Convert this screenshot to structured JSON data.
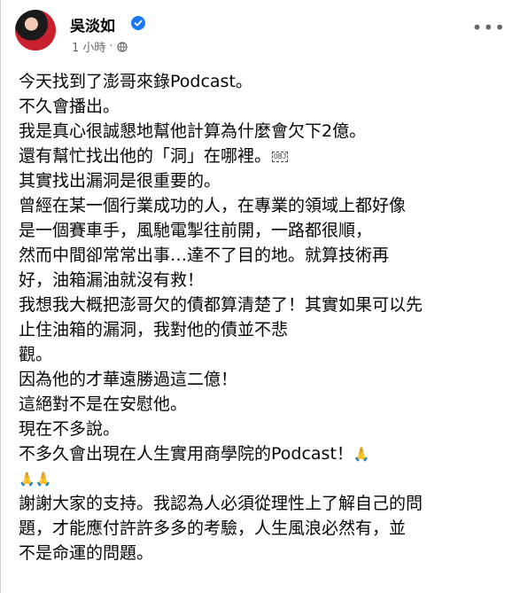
{
  "post": {
    "author": "吳淡如",
    "time": "1 小時",
    "dot": "·",
    "verified_icon": "verified-badge-icon",
    "privacy_icon": "globe-icon",
    "more_icon": "more-options-icon"
  },
  "lines": [
    "今天找到了澎哥來錄Podcast。",
    "不久會播出。",
    "我是真心很誠懇地幫他計算為什麼會欠下2億。",
    "還有幫忙找出他的「洞」在哪裡。",
    "其實找出漏洞是很重要的。",
    "曾經在某一個行業成功的人，在專業的領域上都好像",
    "是一個賽車手，風馳電掣往前開，一路都很順，",
    "然而中間卻常常出事…達不了目的地。就算技術再",
    "好，油箱漏油就沒有救！",
    "我想我大概把澎哥欠的債都算清楚了！其實如果可以先",
    "止住油箱的漏洞，我對他的債並不悲",
    "觀。",
    "因為他的才華遠勝過這二億！",
    "這絕對不是在安慰他。",
    "現在不多說。",
    "不多久會出現在人生實用商學院的Podcast！",
    "",
    "謝謝大家的支持。我認為人必須從理性上了解自己的問",
    "題，才能應付許許多多的考驗，人生風浪必然有，並",
    "不是命運的問題。"
  ]
}
